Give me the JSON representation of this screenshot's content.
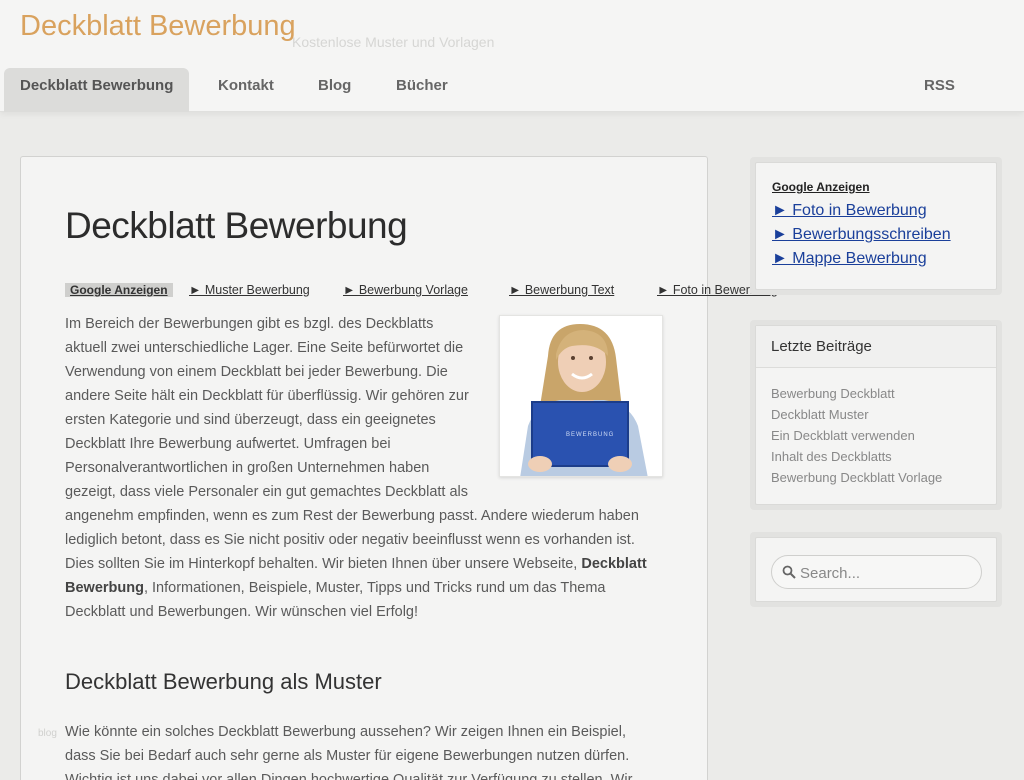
{
  "header": {
    "title": "Deckblatt Bewerbung",
    "description": "Kostenlose Muster und Vorlagen"
  },
  "nav": {
    "items": [
      {
        "label": "Deckblatt Bewerbung"
      },
      {
        "label": "Kontakt"
      },
      {
        "label": "Blog"
      },
      {
        "label": "Bücher"
      }
    ],
    "rss": "RSS"
  },
  "main": {
    "title": "Deckblatt Bewerbung",
    "ads_label": "Google Anzeigen",
    "ad_links": [
      "► Muster Bewerbung",
      "► Bewerbung Vorlage",
      "► Bewerbung Text",
      "► Foto in Bewerbung"
    ],
    "photo_caption": "BEWERBUNG",
    "paragraph1_a": "Im Bereich der Bewerbungen gibt es bzgl. des Deckblatts aktuell zwei unterschiedliche Lager. Eine Seite befürwortet die Verwendung von einem Deckblatt bei jeder Bewerbung. Die andere Seite hält ein Deckblatt für überflüssig. Wir gehören zur ersten Kategorie und sind überzeugt, dass ein geeignetes Deckblatt Ihre Bewerbung aufwertet. Umfragen bei Personalverantwortlichen in großen Unternehmen haben gezeigt, dass viele Personaler ein gut gemachtes Deckblatt als angenehm empfinden, wenn es zum Rest der Bewerbung passt. Andere wiederum haben lediglich betont, dass es Sie nicht positiv oder negativ beeinflusst wenn es vorhanden ist. Dies sollten Sie im Hinterkopf behalten. Wir bieten Ihnen über unsere Webseite, ",
    "paragraph1_bold": "Deckblatt Bewerbung",
    "paragraph1_b": ", Informationen, Beispiele, Muster, Tipps und Tricks rund um das Thema Deckblatt und Bewerbungen. Wir wünschen viel Erfolg!",
    "subheading": "Deckblatt Bewerbung als Muster",
    "paragraph2": "Wie könnte ein solches Deckblatt Bewerbung aussehen? Wir zeigen Ihnen ein Beispiel, dass Sie bei Bedarf auch sehr gerne als Muster für eigene Bewerbungen nutzen dürfen. Wichtig ist uns dabei vor allen Dingen hochwertige Qualität zur Verfügung zu stellen. Wir"
  },
  "watermark": "blog",
  "sidebar": {
    "ads_label": "Google Anzeigen",
    "ad_links": [
      "► Foto in Bewerbung",
      "► Bewerbungsschreiben",
      "► Mappe Bewerbung"
    ],
    "recent_title": "Letzte Beiträge",
    "recent_posts": [
      "Bewerbung Deckblatt",
      "Deckblatt Muster",
      "Ein Deckblatt verwenden",
      "Inhalt des Deckblatts",
      "Bewerbung Deckblatt Vorlage"
    ],
    "search_placeholder": "Search..."
  },
  "colors": {
    "title_accent": "#d9a25e",
    "link_blue": "#1a3f9a"
  }
}
